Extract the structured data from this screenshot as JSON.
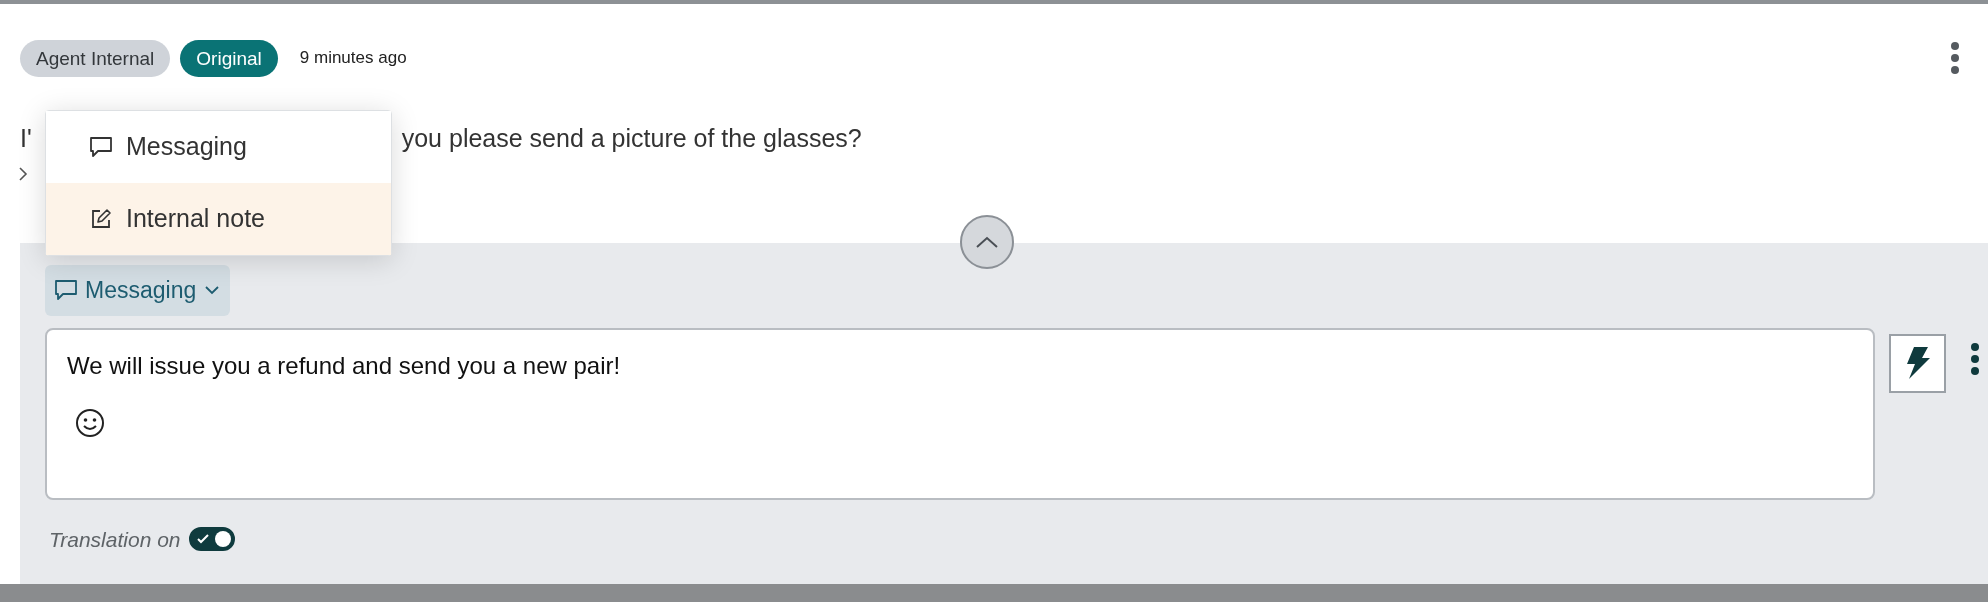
{
  "tags": [
    {
      "label": "Agent Internal",
      "kind": "neutral"
    },
    {
      "label": "Original",
      "kind": "accent"
    }
  ],
  "timestamp": "9 minutes ago",
  "message": {
    "visible_start": "I'",
    "visible_end": "you please send a picture of the glasses?"
  },
  "replies_expanded": false,
  "channel_menu": {
    "items": [
      {
        "label": "Messaging",
        "kind": "chat",
        "highlighted": false
      },
      {
        "label": "Internal note",
        "kind": "note",
        "highlighted": true
      }
    ]
  },
  "composer": {
    "channel": "Messaging",
    "text": "We will issue you a refund and send you a new pair!",
    "translation": {
      "label": "Translation on",
      "on": true
    }
  }
}
